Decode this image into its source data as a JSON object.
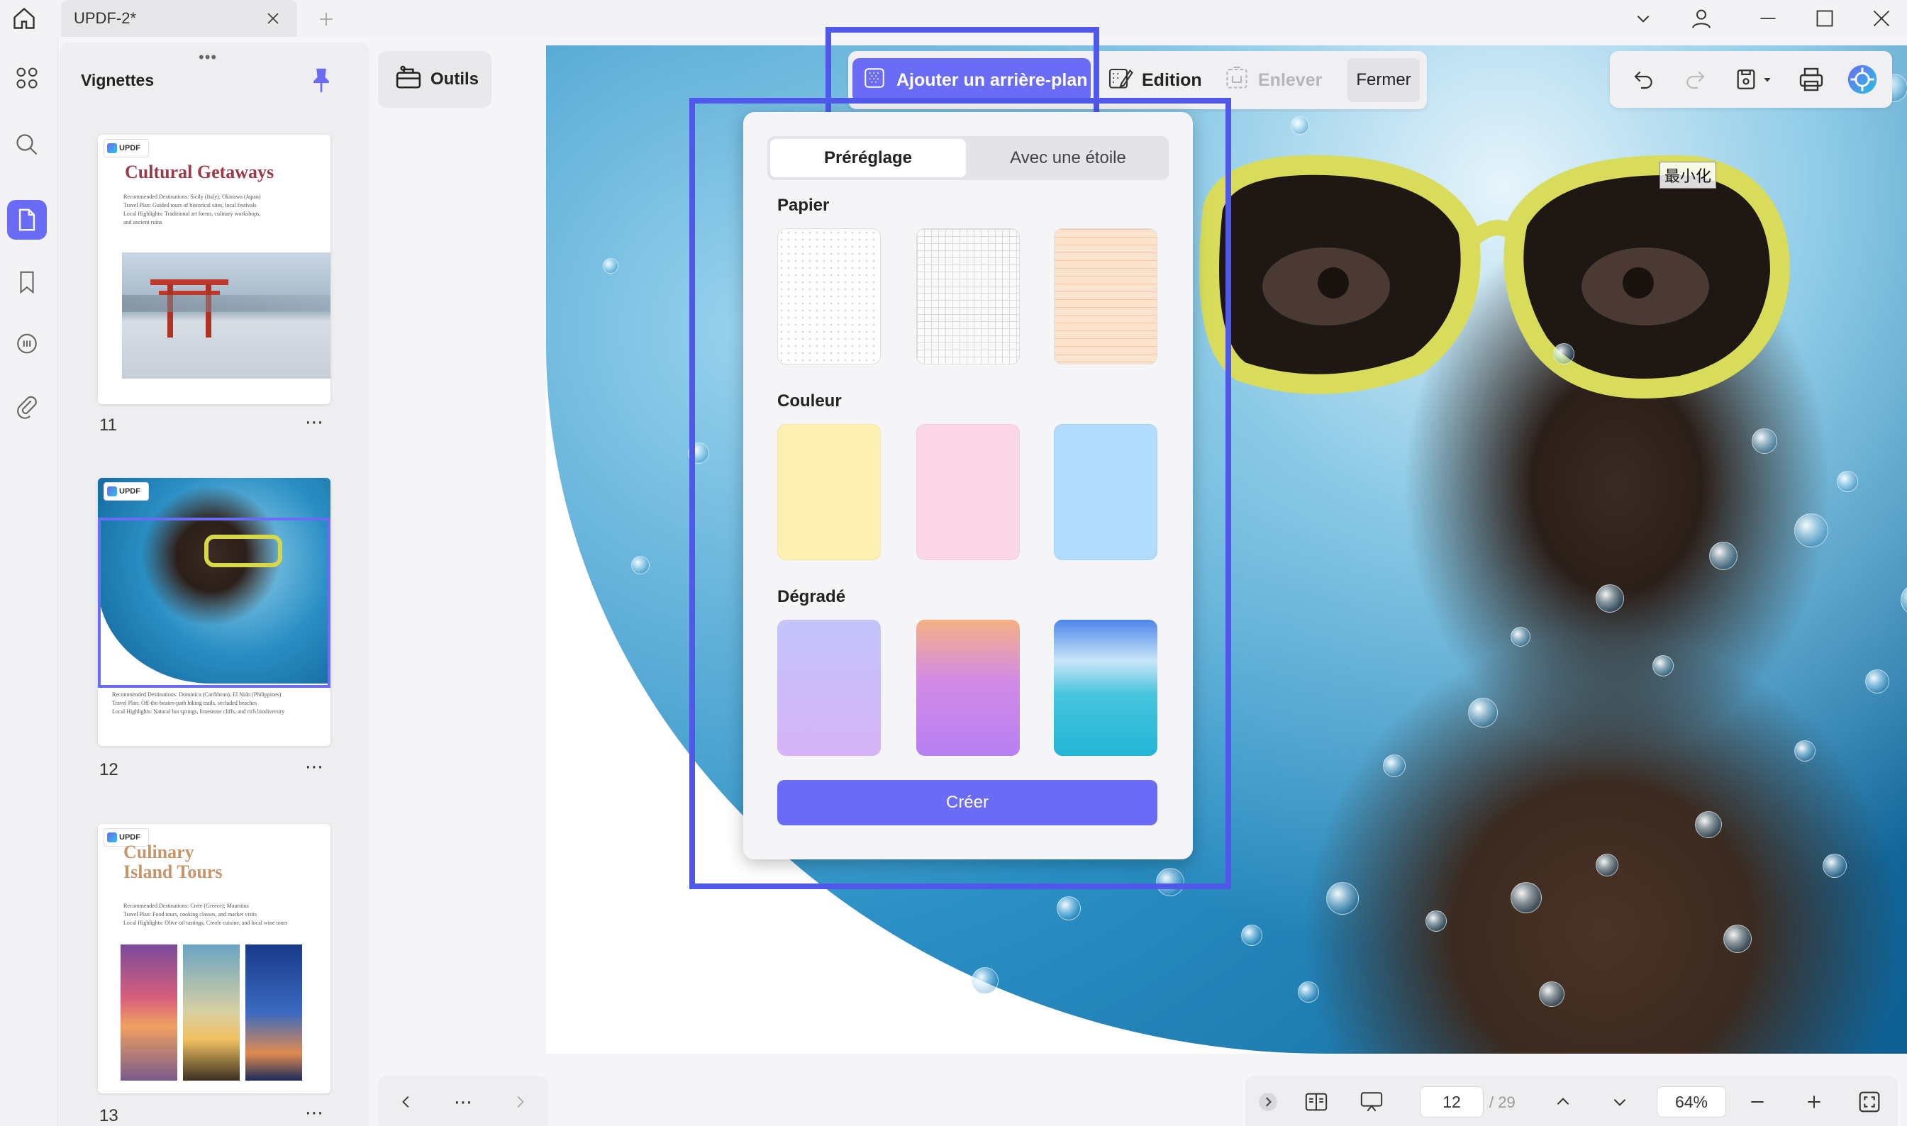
{
  "window": {
    "tab_title": "UPDF-2*"
  },
  "thumbnails": {
    "title": "Vignettes",
    "pages": [
      {
        "number": "11",
        "heading": "Cultural Getaways",
        "lines": [
          "Recommended Destinations: Sicily (Italy); Okinawa (Japan)",
          "Travel Plan: Guided tours of historical sites, local festivals",
          "Local Highlights: Traditional art forms, culinary workshops,",
          "and ancient ruins"
        ]
      },
      {
        "number": "12",
        "lines": [
          "Recommended Destinations: Dominica (Caribbean), El Nido (Philippines)",
          "Travel Plan: Off-the-beaten-path hiking trails, secluded beaches",
          "Local Highlights: Natural hot springs, limestone cliffs, and rich biodiversity"
        ]
      },
      {
        "number": "13",
        "heading_1": "Culinary",
        "heading_2": "Island Tours",
        "lines": [
          "Recommended Destinations: Crete (Greece); Mauritius",
          "Travel Plan: Food tours, cooking classes, and market visits",
          "Local Highlights: Olive oil tastings, Creole cuisine, and local wine tours"
        ]
      }
    ],
    "more_label": "⋯",
    "logo_text": "UPDF"
  },
  "tools": {
    "label": "Outils"
  },
  "context_toolbar": {
    "add_background": "Ajouter un arrière-plan",
    "edit": "Edition",
    "remove": "Enlever",
    "close": "Fermer"
  },
  "overlay": {
    "minimize": "最小化"
  },
  "background_panel": {
    "tabs": {
      "preset": "Préréglage",
      "with_star": "Avec une étoile"
    },
    "sections": {
      "paper": "Papier",
      "color": "Couleur",
      "gradient": "Dégradé"
    },
    "colors": {
      "yellow": "#fdf0b3",
      "pink": "#fcd7e6",
      "blue": "#b3dcfc"
    },
    "create_button": "Créer"
  },
  "status_bar": {
    "current_page": "12",
    "total_pages": "/ 29",
    "zoom": "64%"
  },
  "nav": {
    "more": "⋯"
  },
  "accent_color": "#6a6cf6"
}
